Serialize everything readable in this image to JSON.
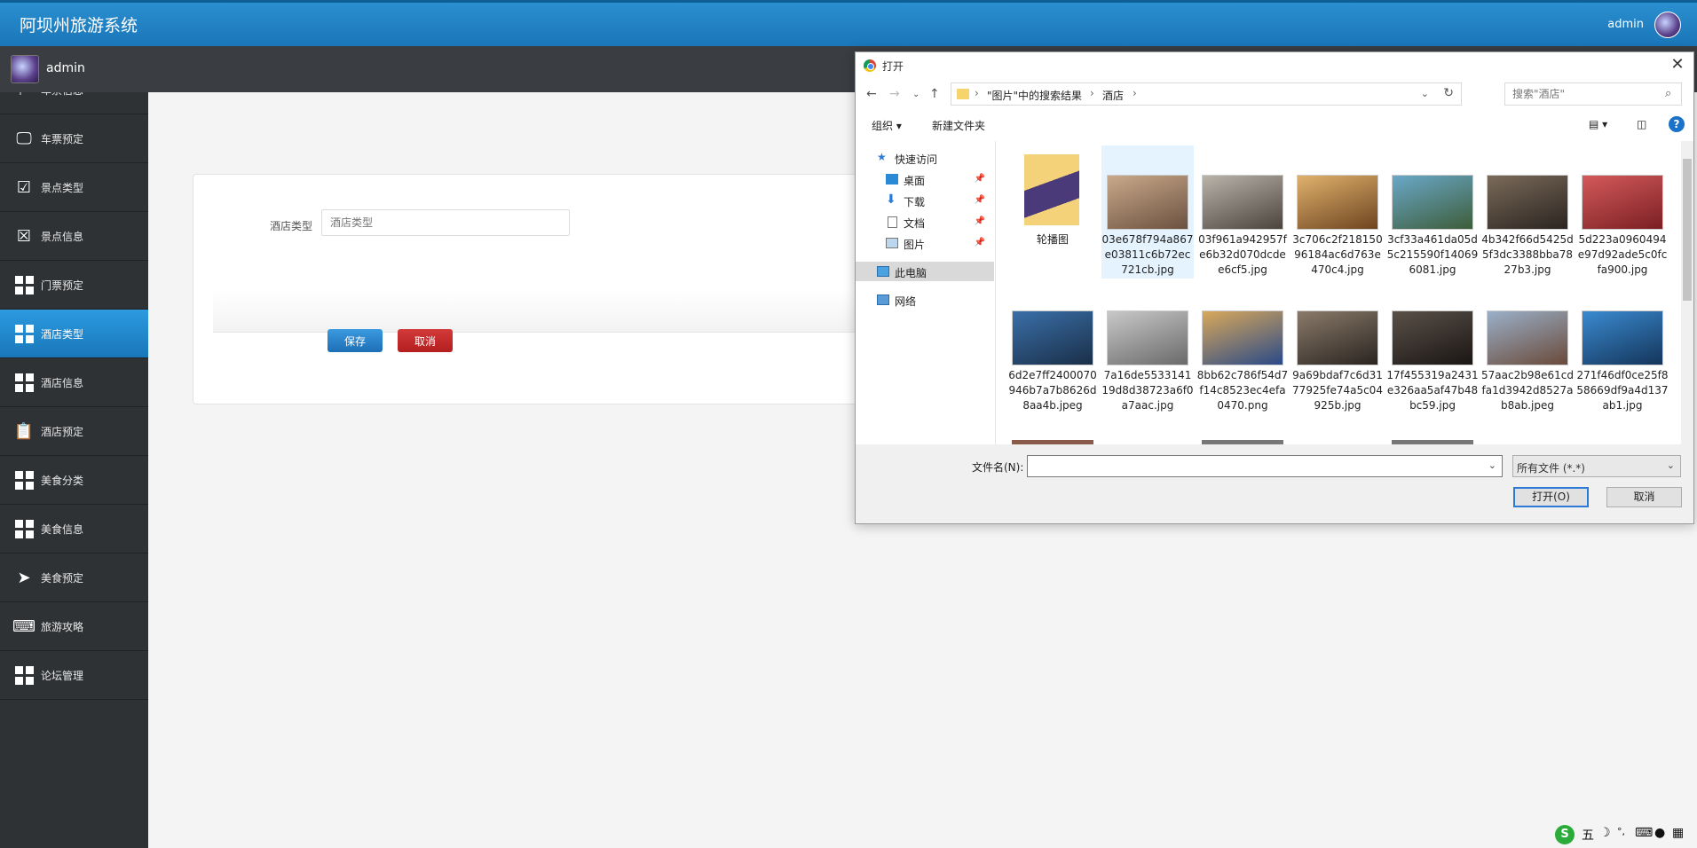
{
  "header": {
    "title": "阿坝州旅游系统",
    "user": "admin"
  },
  "subbar": {
    "name": "admin"
  },
  "sidebar": {
    "items": [
      {
        "label": "车票信息",
        "icon": "flag-icon"
      },
      {
        "label": "车票预定",
        "icon": "monitor-icon"
      },
      {
        "label": "景点类型",
        "icon": "clipboard-check-icon"
      },
      {
        "label": "景点信息",
        "icon": "clipboard-x-icon"
      },
      {
        "label": "门票预定",
        "icon": "grid-icon"
      },
      {
        "label": "酒店类型",
        "icon": "grid-icon",
        "active": true
      },
      {
        "label": "酒店信息",
        "icon": "grid-icon"
      },
      {
        "label": "酒店预定",
        "icon": "clipboard-icon"
      },
      {
        "label": "美食分类",
        "icon": "grid-icon"
      },
      {
        "label": "美食信息",
        "icon": "grid-icon"
      },
      {
        "label": "美食预定",
        "icon": "paper-plane-icon"
      },
      {
        "label": "旅游攻略",
        "icon": "laptop-icon"
      },
      {
        "label": "论坛管理",
        "icon": "grid-icon"
      }
    ]
  },
  "form": {
    "field_label": "酒店类型",
    "field_placeholder": "酒店类型",
    "save_label": "保存",
    "cancel_label": "取消"
  },
  "dialog": {
    "title": "打开",
    "breadcrumb": [
      "\"图片\"中的搜索结果",
      "酒店"
    ],
    "search_placeholder": "搜索\"酒店\"",
    "toolbar": {
      "organize": "组织 ▾",
      "new_folder": "新建文件夹"
    },
    "nav": {
      "quick_access": "快速访问",
      "desktop": "桌面",
      "downloads": "下载",
      "documents": "文档",
      "pictures": "图片",
      "this_pc": "此电脑",
      "network": "网络"
    },
    "files": [
      {
        "name": "轮播图",
        "type": "folder"
      },
      {
        "name": "03e678f794a867e03811c6b72ec721cb.jpg",
        "color1": "#c9a98a",
        "color2": "#6b5140"
      },
      {
        "name": "03f961a942957fe6b32d070dcdee6cf5.jpg",
        "color1": "#b9b3aa",
        "color2": "#4a443d"
      },
      {
        "name": "3c706c2f21815096184ac6d763e470c4.jpg",
        "color1": "#e0b16c",
        "color2": "#6e4420"
      },
      {
        "name": "3cf33a461da05d5c215590f140696081.jpg",
        "color1": "#6aa8c8",
        "color2": "#3d5d3a"
      },
      {
        "name": "4b342f66d5425d5f3dc3388bba7827b3.jpg",
        "color1": "#7a6a5a",
        "color2": "#2b2420"
      },
      {
        "name": "5d223a0960494e97d92ade5c0fcfa900.jpg",
        "color1": "#d45a5a",
        "color2": "#7a1f24"
      },
      {
        "name": "6d2e7ff2400070946b7a7b8626d8aa4b.jpeg",
        "color1": "#3a6fa8",
        "color2": "#1a2f48"
      },
      {
        "name": "7a16de553314119d8d38723a6f0a7aac.jpg",
        "color1": "#c8c8c8",
        "color2": "#6a6a6a"
      },
      {
        "name": "8bb62c786f54d7f14c8523ec4efa0470.png",
        "color1": "#d9a85a",
        "color2": "#2a4a88"
      },
      {
        "name": "9a69bdaf7c6d3177925fe74a5c04925b.jpg",
        "color1": "#8a7a6a",
        "color2": "#2a2420"
      },
      {
        "name": "17f455319a2431e326aa5af47b48bc59.jpg",
        "color1": "#5a5048",
        "color2": "#1a1614"
      },
      {
        "name": "57aac2b98e61cdfa1d3942d8527ab8ab.jpeg",
        "color1": "#9ab0c8",
        "color2": "#6a4a3a"
      },
      {
        "name": "271f46df0ce25f858669df9a4d137ab1.jpg",
        "color1": "#3a8ad0",
        "color2": "#14355a"
      }
    ],
    "filename_label": "文件名(N):",
    "filetype": "所有文件 (*.*)",
    "open_label": "打开(O)",
    "cancel_label": "取消"
  },
  "ime": {
    "label": "五"
  }
}
